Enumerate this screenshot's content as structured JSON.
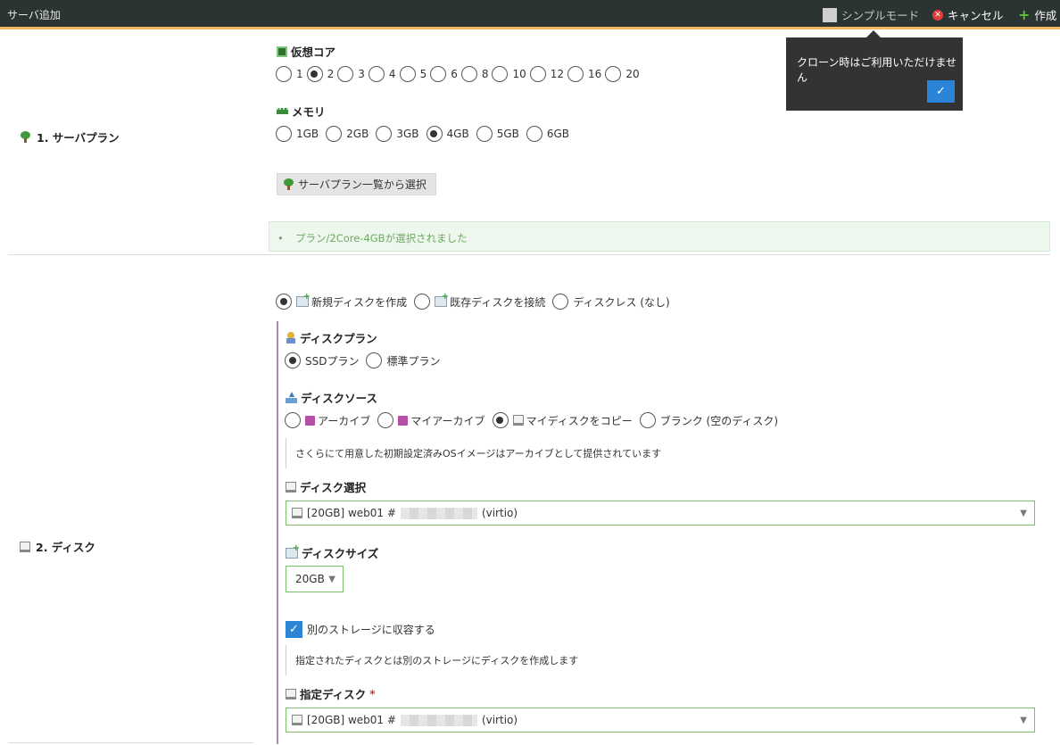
{
  "header": {
    "title": "サーバ追加",
    "simple_mode": "シンプルモード",
    "cancel": "キャンセル",
    "create": "作成"
  },
  "tooltip": {
    "message": "クローン時はご利用いただけません",
    "ok": "✓"
  },
  "sections": {
    "plan": {
      "label": "1. サーバプラン",
      "cpu_label": "仮想コア",
      "cpu_options": [
        "1",
        "2",
        "3",
        "4",
        "5",
        "6",
        "8",
        "10",
        "12",
        "16",
        "20"
      ],
      "cpu_selected": "2",
      "memory_label": "メモリ",
      "memory_options": [
        "1GB",
        "2GB",
        "3GB",
        "4GB",
        "5GB",
        "6GB"
      ],
      "memory_selected": "4GB",
      "plan_list_button": "サーバプラン一覧から選択",
      "success_bullet": "•",
      "success_message": "プラン/2Core-4GBが選択されました"
    },
    "disk": {
      "label": "2. ディスク",
      "mode_options": [
        "新規ディスクを作成",
        "既存ディスクを接続",
        "ディスクレス (なし)"
      ],
      "mode_selected": "新規ディスクを作成",
      "disk_plan_label": "ディスクプラン",
      "disk_plan_options": [
        "SSDプラン",
        "標準プラン"
      ],
      "disk_plan_selected": "SSDプラン",
      "disk_source_label": "ディスクソース",
      "disk_source_options": [
        "アーカイブ",
        "マイアーカイブ",
        "マイディスクをコピー",
        "ブランク (空のディスク)"
      ],
      "disk_source_selected": "マイディスクをコピー",
      "source_note": "さくらにて用意した初期設定済みOSイメージはアーカイブとして提供されています",
      "disk_select_label": "ディスク選択",
      "disk_select_prefix": "[20GB] web01 #",
      "disk_select_suffix": "(virtio)",
      "disk_size_label": "ディスクサイズ",
      "disk_size_value": "20GB",
      "other_storage_label": "別のストレージに収容する",
      "other_storage_checked": true,
      "other_storage_note": "指定されたディスクとは別のストレージにディスクを作成します",
      "target_disk_label": "指定ディスク",
      "target_disk_required": "*",
      "target_disk_prefix": "[20GB] web01 #",
      "target_disk_suffix": "(virtio)"
    }
  },
  "colors": {
    "topbar": "#2b3333",
    "accent_line": "#f3b562",
    "primary": "#2a85d8",
    "success_text": "#6caa5e",
    "select_border": "#7bbf6a"
  }
}
